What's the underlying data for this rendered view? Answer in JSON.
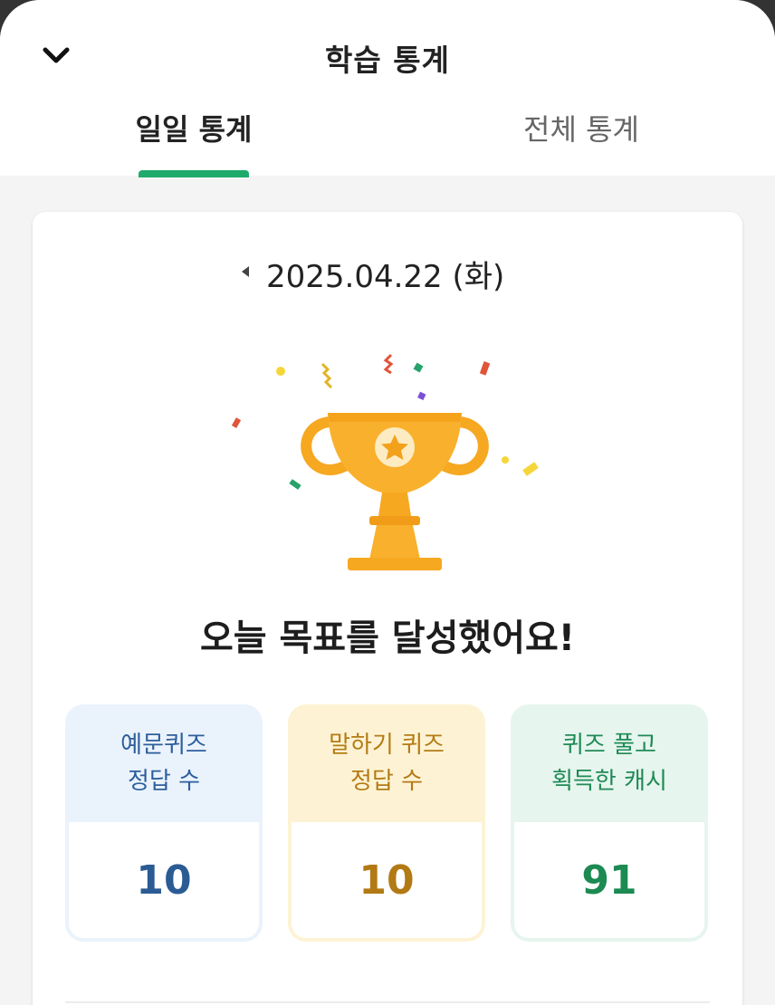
{
  "header": {
    "title": "학습 통계",
    "back_icon": "chevron-down-icon"
  },
  "tabs": [
    {
      "label": "일일 통계",
      "active": true
    },
    {
      "label": "전체 통계",
      "active": false
    }
  ],
  "date": {
    "text": "2025.04.22 (화)",
    "prev_icon": "caret-left-icon"
  },
  "headline": "오늘 목표를 달성했어요!",
  "stats": [
    {
      "line1": "예문퀴즈",
      "line2": "정답 수",
      "value": "10",
      "color": "#2b5b93"
    },
    {
      "line1": "말하기 퀴즈",
      "line2": "정답 수",
      "value": "10",
      "color": "#b27a14"
    },
    {
      "line1": "퀴즈 풀고",
      "line2": "획득한 캐시",
      "value": "91",
      "color": "#1c8a52"
    }
  ],
  "colors": {
    "accent": "#1faa6b",
    "trophy": "#f7a824"
  }
}
